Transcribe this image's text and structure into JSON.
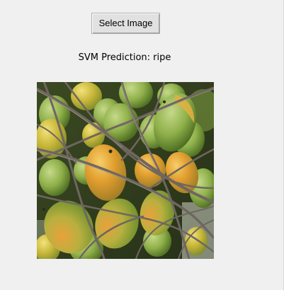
{
  "window": {
    "background": "#f0f0f0"
  },
  "select_button": {
    "label": "Select Image"
  },
  "prediction": {
    "label": "SVM Prediction: ripe",
    "model": "SVM",
    "result": "ripe"
  },
  "image": {
    "description": "Cluster of green and yellow-orange palm fruits (betel nuts) hanging on a bunch with grey stalks",
    "colors": {
      "unripe": "#8fb04a",
      "ripening": "#c9b83a",
      "ripe": "#e3a030",
      "stalk": "#6f6660",
      "background": "#2f3d1c"
    }
  }
}
